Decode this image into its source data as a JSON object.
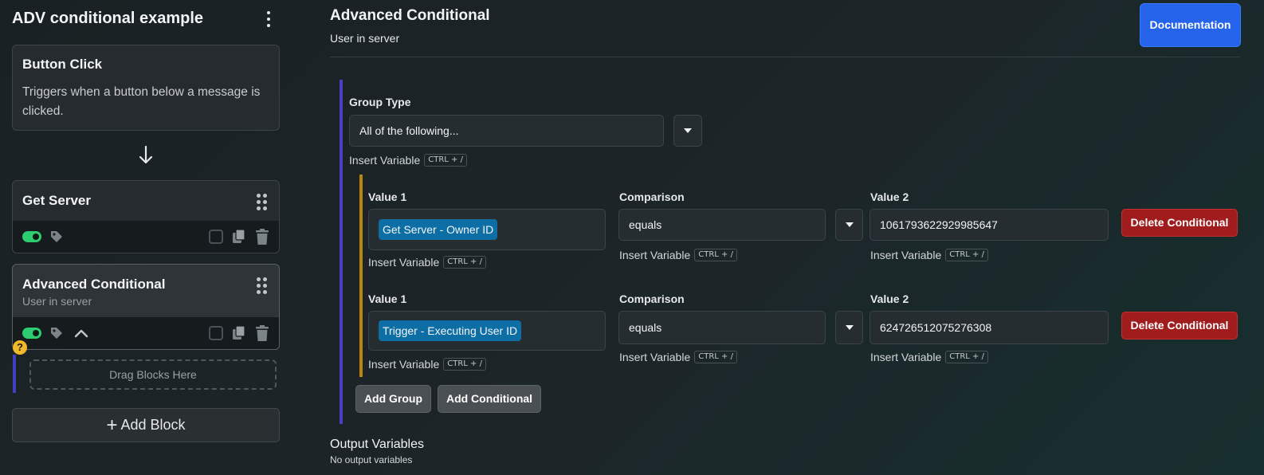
{
  "sidebar": {
    "title": "ADV conditional example",
    "trigger": {
      "title": "Button Click",
      "description": "Triggers when a button below a message is clicked."
    },
    "blocks": [
      {
        "title": "Get Server",
        "enabled": true
      },
      {
        "title": "Advanced Conditional",
        "subtitle": "User in server",
        "enabled": true
      }
    ],
    "help_glyph": "?",
    "drop_zone": "Drag Blocks Here",
    "add_block": {
      "plus": "+",
      "label": "Add Block"
    }
  },
  "main": {
    "title": "Advanced Conditional",
    "subtitle": "User in server",
    "documentation_button": "Documentation",
    "group": {
      "type_label": "Group Type",
      "type_value": "All of the following...",
      "insert_variable": "Insert Variable",
      "shortcut": "CTRL + /"
    },
    "conditionals": [
      {
        "value1_label": "Value 1",
        "value1_chip": "Get Server - Owner ID",
        "comparison_label": "Comparison",
        "comparison_value": "equals",
        "value2_label": "Value 2",
        "value2_value": "1061793622929985647",
        "delete_label": "Delete Conditional"
      },
      {
        "value1_label": "Value 1",
        "value1_chip": "Trigger - Executing User ID",
        "comparison_label": "Comparison",
        "comparison_value": "equals",
        "value2_label": "Value 2",
        "value2_value": "624726512075276308",
        "delete_label": "Delete Conditional"
      }
    ],
    "insert_variable": "Insert Variable",
    "shortcut": "CTRL + /",
    "add_group": "Add Group",
    "add_conditional": "Add Conditional",
    "output_variables_title": "Output Variables",
    "output_variables_empty": "No output variables"
  },
  "colors": {
    "accent_blue": "#2563eb",
    "group_bar": "#4b3fc2",
    "conditional_bar": "#b8860b",
    "delete_red": "#a11d1d",
    "variable_chip": "#0d6ea6",
    "toggle_on": "#2ecc71"
  },
  "icons": [
    "kebab-menu-icon",
    "arrow-down-icon",
    "drag-handle-icon",
    "tag-icon",
    "chevron-up-icon",
    "copy-icon",
    "trash-icon",
    "caret-down-icon",
    "help-icon"
  ]
}
